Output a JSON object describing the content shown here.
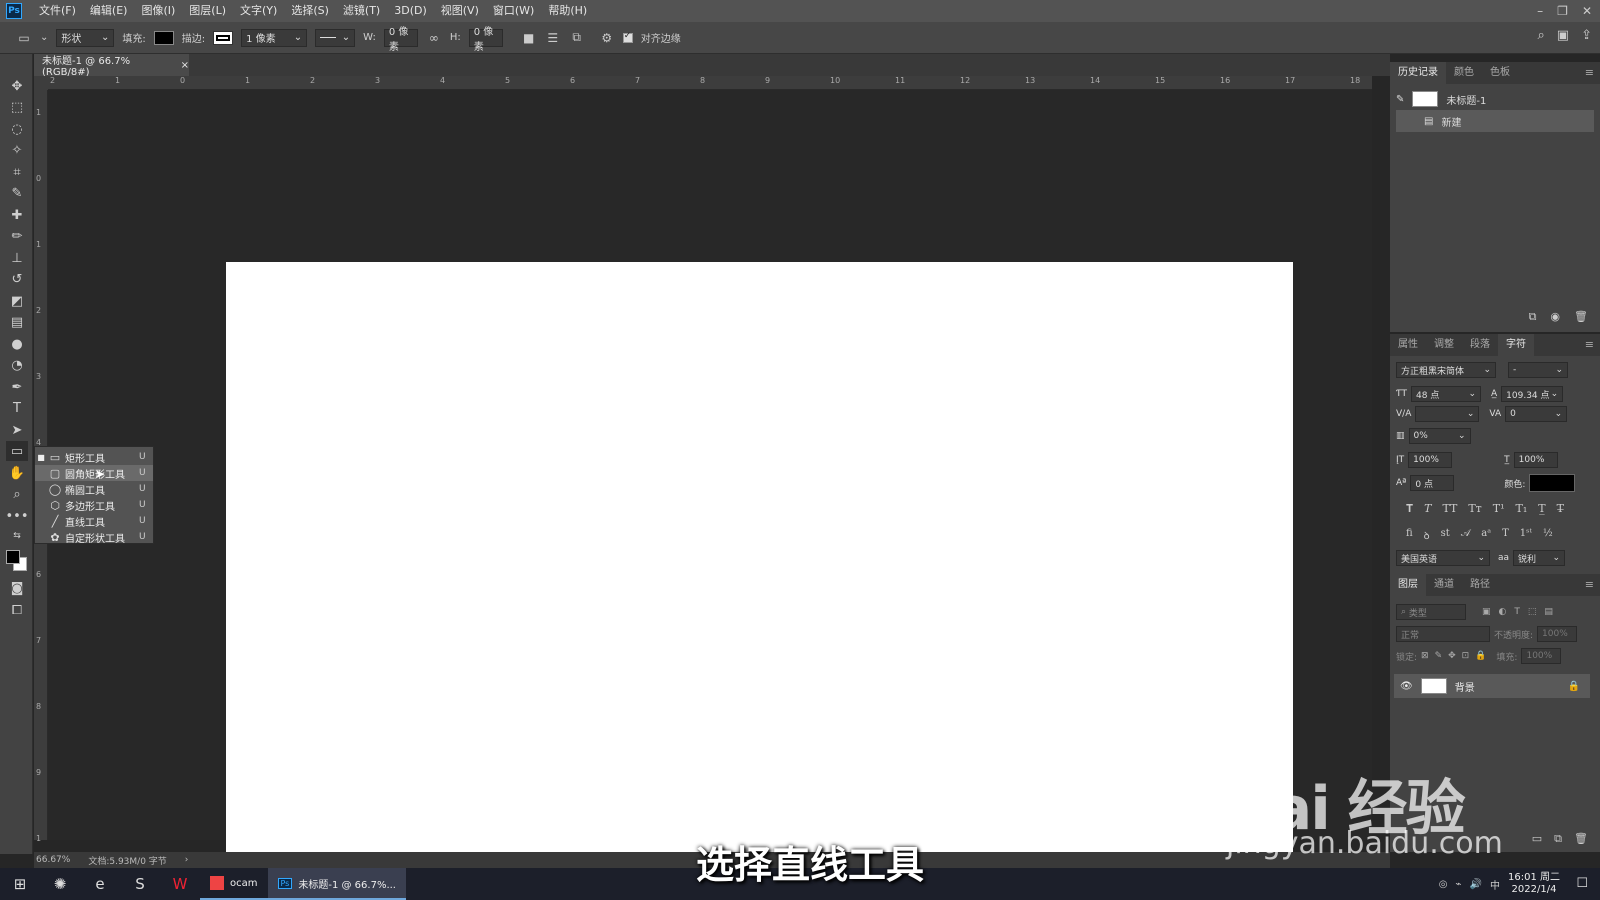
{
  "app": {
    "logo": "Ps",
    "menus": [
      "文件(F)",
      "编辑(E)",
      "图像(I)",
      "图层(L)",
      "文字(Y)",
      "选择(S)",
      "滤镜(T)",
      "3D(D)",
      "视图(V)",
      "窗口(W)",
      "帮助(H)"
    ]
  },
  "options": {
    "mode": "形状",
    "fill_label": "填充:",
    "stroke_label": "描边:",
    "stroke_width": "1 像素",
    "w_label": "W:",
    "w_value": "0 像素",
    "h_label": "H:",
    "h_value": "0 像素",
    "align_edges": "对齐边缘",
    "fill_color": "#000000"
  },
  "document": {
    "tab_title": "未标题-1 @ 66.7%(RGB/8#)",
    "zoom": "66.67%",
    "doc_info": "文档:5.93M/0 字节"
  },
  "rulers": {
    "top": [
      "2",
      "1",
      "0",
      "1",
      "2",
      "3",
      "4",
      "5",
      "6",
      "7",
      "8",
      "9",
      "10",
      "11",
      "12",
      "13",
      "14",
      "15",
      "16",
      "17",
      "18"
    ],
    "left": [
      "1",
      "0",
      "1",
      "2",
      "3",
      "4",
      "5",
      "6",
      "7",
      "8",
      "9",
      "1"
    ]
  },
  "flyout": {
    "items": [
      {
        "label": "矩形工具",
        "key": "U",
        "icon": "rectangle-icon"
      },
      {
        "label": "圆角矩形工具",
        "key": "U",
        "icon": "rounded-rectangle-icon"
      },
      {
        "label": "椭圆工具",
        "key": "U",
        "icon": "ellipse-icon"
      },
      {
        "label": "多边形工具",
        "key": "U",
        "icon": "polygon-icon"
      },
      {
        "label": "直线工具",
        "key": "U",
        "icon": "line-icon"
      },
      {
        "label": "自定形状工具",
        "key": "U",
        "icon": "custom-shape-icon"
      }
    ]
  },
  "history_panel": {
    "tabs": [
      "历史记录",
      "颜色",
      "色板"
    ],
    "snapshot": "未标题-1",
    "step": "新建"
  },
  "character_panel": {
    "tabs": [
      "属性",
      "调整",
      "段落",
      "字符"
    ],
    "font_family": "方正粗黑宋简体",
    "font_style": "-",
    "font_size": "48 点",
    "leading": "109.34 点",
    "tracking": "0",
    "scale_percent": "0%",
    "vertical_scale": "100%",
    "horizontal_scale": "100%",
    "baseline": "0 点",
    "color_label": "颜色:",
    "language": "美国英语",
    "aa_label": "aa",
    "antialias": "锐利",
    "color": "#000000"
  },
  "layers_panel": {
    "tabs": [
      "图层",
      "通道",
      "路径"
    ],
    "filter": "类型",
    "blend_mode": "正常",
    "opacity_label": "不透明度:",
    "opacity": "100%",
    "lock_label": "锁定:",
    "fill_label": "填充:",
    "fill": "100%",
    "layer_name": "背景"
  },
  "taskbar": {
    "apps": [
      {
        "label": "ocam"
      },
      {
        "label": "未标题-1 @ 66.7%..."
      }
    ],
    "time": "16:01 周二",
    "date": "2022/1/4",
    "ime": "中"
  },
  "overlay": {
    "subtitle": "选择直线工具",
    "watermark_logo": "Bai 经验",
    "watermark_url": "jingyan.baidu.com"
  }
}
